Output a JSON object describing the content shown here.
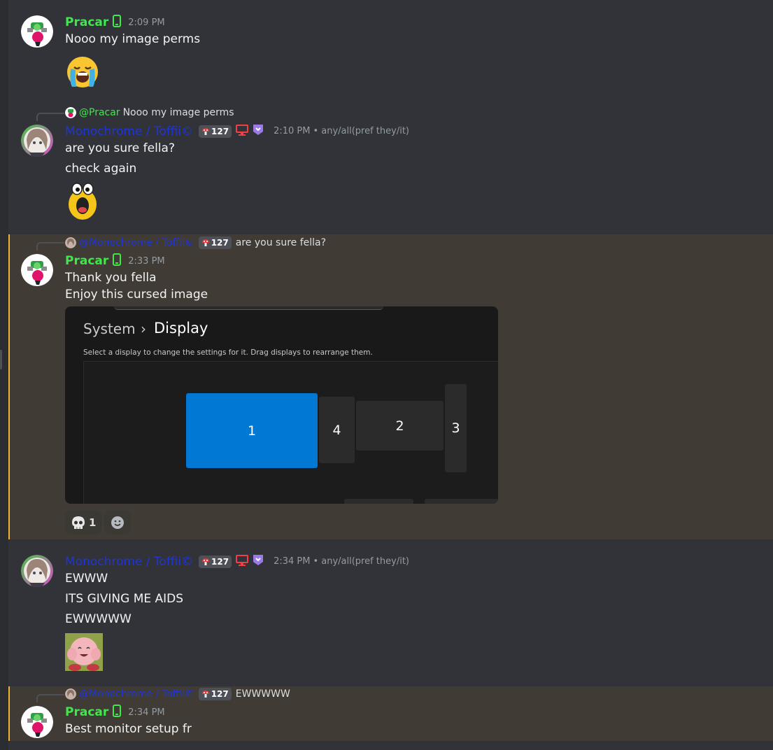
{
  "messages": [
    {
      "author": "Pracar",
      "timestamp": "2:09 PM",
      "lines": [
        "Nooo my image perms"
      ],
      "emoji": "loudly-crying-emoji"
    },
    {
      "reply": {
        "mention": "@Pracar",
        "text": "Nooo my image perms"
      },
      "author": "Monochrome / Toffii©",
      "badge": "127",
      "timestamp": "2:10 PM",
      "pronouns": "• any/all(pref they/it)",
      "lines": [
        "are you sure fella?",
        "check again"
      ],
      "emoji": "shocked-yellow-emoji"
    },
    {
      "reply": {
        "mention": "@Monochrome / Toffii©",
        "badge": "127",
        "text": "are you sure fella?"
      },
      "author": "Pracar",
      "timestamp": "2:33 PM",
      "lines": [
        "Thank you fella",
        "Enjoy this cursed image"
      ],
      "embed": {
        "crumb_parent": "System",
        "chevron": "›",
        "crumb_current": "Display",
        "description": "Select a display to change the settings for it. Drag displays to rearrange them.",
        "monitors": [
          "1",
          "4",
          "2",
          "3"
        ]
      },
      "reactions": [
        {
          "emoji": "skull",
          "count": "1"
        }
      ]
    },
    {
      "author": "Monochrome / Toffii©",
      "badge": "127",
      "timestamp": "2:34 PM",
      "pronouns": "• any/all(pref they/it)",
      "lines": [
        "EWWW",
        "ITS GIVING ME AIDS",
        "EWWWWW"
      ],
      "emoji": "kirby-face-sticker"
    },
    {
      "reply": {
        "mention": "@Monochrome / Toffii©",
        "badge": "127",
        "text": "EWWWWW"
      },
      "author": "Pracar",
      "timestamp": "2:34 PM",
      "lines": [
        "Best monitor setup fr"
      ]
    }
  ],
  "colors": {
    "background": "#313338",
    "highlight": "#403c35",
    "highlight_bar": "#f0b232",
    "pracar_name": "#3ee84a",
    "monochrome_name": "#1d35d9",
    "accent_blue": "#0078d4"
  }
}
